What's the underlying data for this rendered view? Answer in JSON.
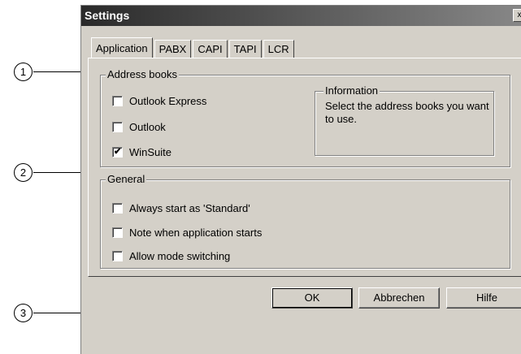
{
  "callouts": [
    "1",
    "2",
    "3"
  ],
  "dialog": {
    "title": "Settings",
    "close_glyph": "x",
    "tabs": [
      "Application",
      "PABX",
      "CAPI",
      "TAPI",
      "LCR"
    ],
    "active_tab": "Application"
  },
  "address_books": {
    "legend": "Address books",
    "options": [
      {
        "label": "Outlook Express",
        "checked": false
      },
      {
        "label": "Outlook",
        "checked": false
      },
      {
        "label": "WinSuite",
        "checked": true
      }
    ],
    "info_legend": "Information",
    "info_text": "Select the address books you want to use."
  },
  "general": {
    "legend": "General",
    "options": [
      {
        "label": "Always start as 'Standard'",
        "checked": false
      },
      {
        "label": "Note when application starts",
        "checked": false
      },
      {
        "label": "Allow mode switching",
        "checked": false
      }
    ]
  },
  "buttons": {
    "ok": "OK",
    "cancel": "Abbrechen",
    "help": "Hilfe"
  },
  "check_glyph": "✔"
}
